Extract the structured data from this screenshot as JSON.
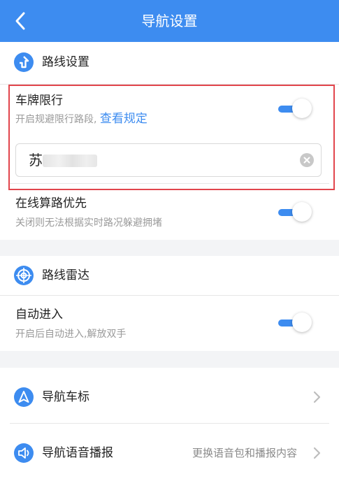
{
  "header": {
    "title": "导航设置",
    "back_icon": "chevron-left-icon"
  },
  "route_settings": {
    "title": "路线设置",
    "icon": "route-turn-icon",
    "plate_restriction": {
      "title": "车牌限行",
      "subtitle": "开启规避限行路段,",
      "link": "查看规定",
      "enabled": true,
      "plate_value": "苏",
      "clear_icon": "clear-circle-icon"
    },
    "online_routing": {
      "title": "在线算路优先",
      "subtitle": "关闭则无法根据实时路况躲避拥堵",
      "enabled": true
    }
  },
  "route_radar": {
    "title": "路线雷达",
    "icon": "radar-icon",
    "auto_enter": {
      "title": "自动进入",
      "subtitle": "开启后自动进入,解放双手",
      "enabled": true
    }
  },
  "nav_items": [
    {
      "label": "导航车标",
      "icon": "navigation-arrow-icon",
      "value": ""
    },
    {
      "label": "导航语音播报",
      "icon": "speaker-icon",
      "value": "更换语音包和播报内容"
    }
  ],
  "colors": {
    "accent": "#3d8cf0",
    "highlight_border": "#e2454c",
    "background": "#f3f4f6"
  }
}
